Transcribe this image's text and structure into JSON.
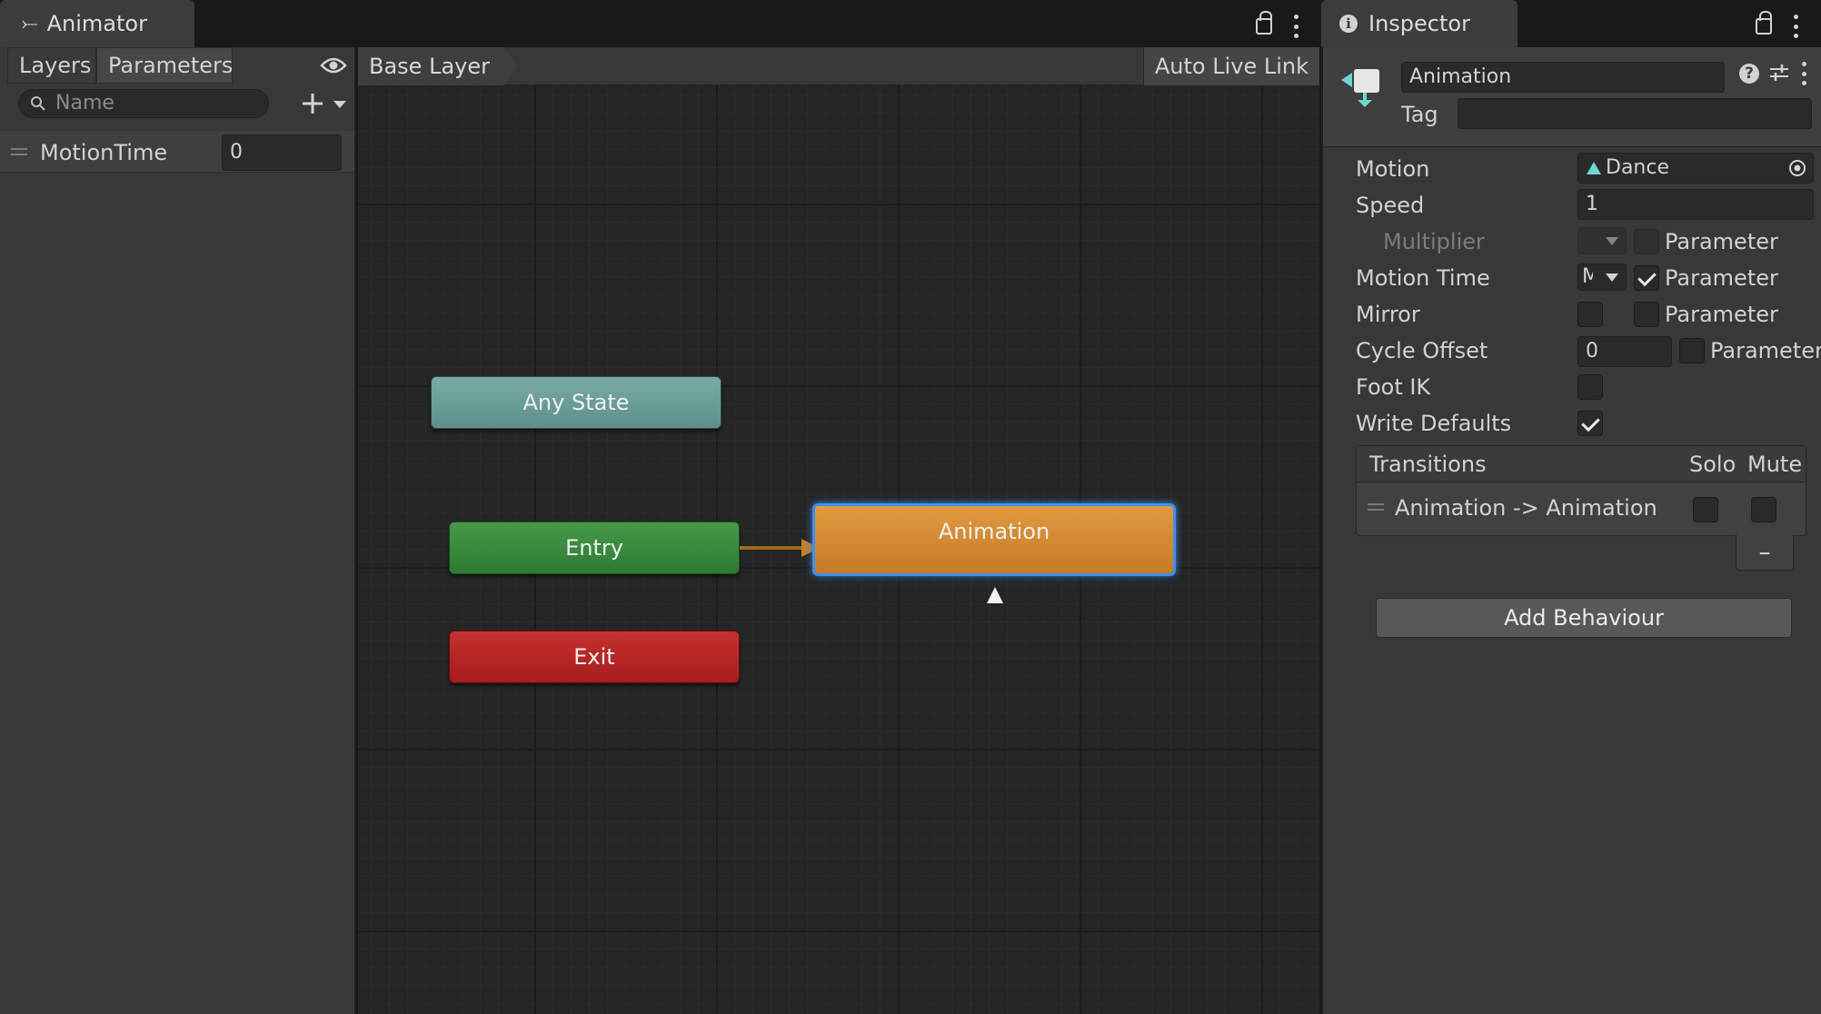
{
  "animator": {
    "tab_label": "Animator",
    "left_tabs": [
      "Layers",
      "Parameters"
    ],
    "search_placeholder": "Name",
    "parameter": {
      "name": "MotionTime",
      "value": "0"
    },
    "breadcrumb": "Base Layer",
    "auto_live_link": "Auto Live Link",
    "nodes": {
      "any_state": "Any State",
      "entry": "Entry",
      "exit": "Exit",
      "animation": "Animation"
    },
    "colors": {
      "any_state": "#6c9f9a",
      "entry": "#3a8a3c",
      "exit": "#b82525",
      "animation": "#dd8f33",
      "selection": "#3f8ff0"
    }
  },
  "inspector": {
    "tab_label": "Inspector",
    "state_name": "Animation",
    "tag_label": "Tag",
    "tag_value": "",
    "rows": {
      "motion": {
        "label": "Motion",
        "value": "Dance"
      },
      "speed": {
        "label": "Speed",
        "value": "1"
      },
      "multiplier": {
        "label": "Multiplier",
        "param_label": "Parameter"
      },
      "motion_time": {
        "label": "Motion Time",
        "dropdown_value": "M",
        "param_label": "Parameter"
      },
      "mirror": {
        "label": "Mirror",
        "param_label": "Parameter"
      },
      "cycle_offset": {
        "label": "Cycle Offset",
        "value": "0",
        "param_label": "Parameter"
      },
      "foot_ik": {
        "label": "Foot IK"
      },
      "write_defaults": {
        "label": "Write Defaults"
      }
    },
    "transitions": {
      "header": "Transitions",
      "solo": "Solo",
      "mute": "Mute",
      "items": [
        {
          "label": "Animation -> Animation"
        }
      ],
      "remove_symbol": "–"
    },
    "add_behaviour": "Add Behaviour"
  }
}
